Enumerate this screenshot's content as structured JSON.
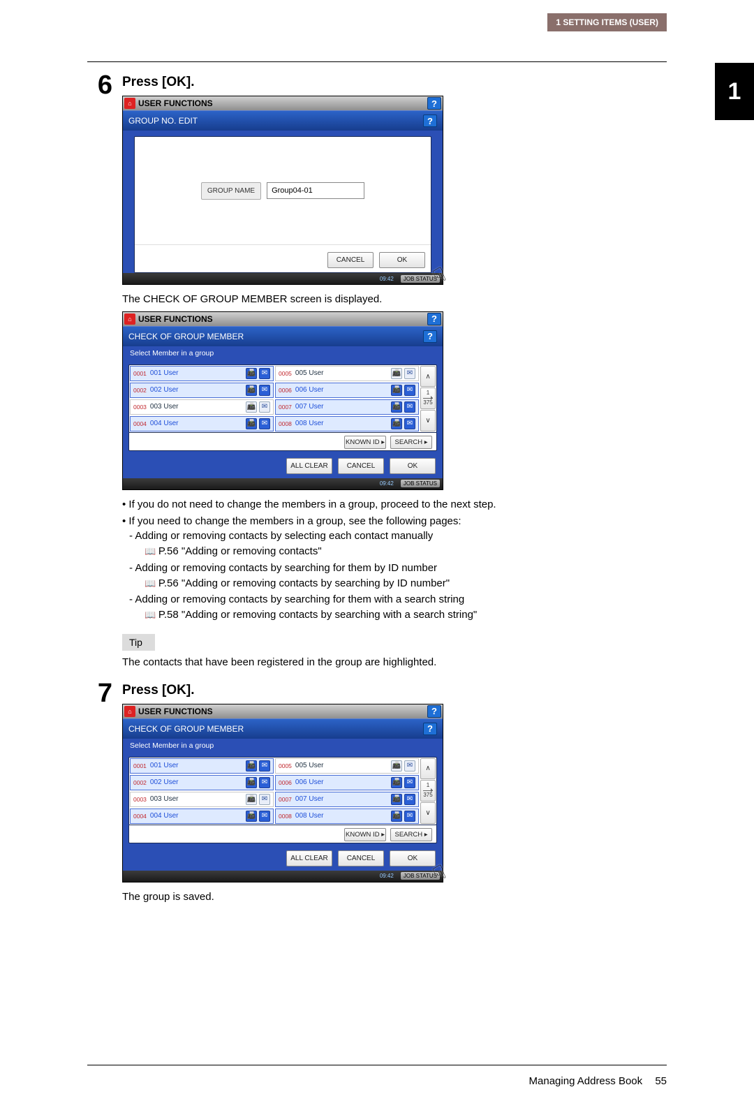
{
  "header": {
    "section": "1 SETTING ITEMS (USER)"
  },
  "chapter_tab": "1",
  "step6": {
    "number": "6",
    "title": "Press [OK].",
    "after_caption": "The CHECK OF GROUP MEMBER screen is displayed.",
    "bullets": [
      "If you do not need to change the members in a group, proceed to the next step.",
      "If you need to change the members in a group, see the following pages:"
    ],
    "subitems": [
      {
        "line": "Adding or removing contacts by selecting each contact manually",
        "ref": "P.56 \"Adding or removing contacts\""
      },
      {
        "line": "Adding or removing contacts by searching for them by ID number",
        "ref": "P.56 \"Adding or removing contacts by searching by ID number\""
      },
      {
        "line": "Adding or removing contacts by searching for them with a search string",
        "ref": "P.58 \"Adding or removing contacts by searching with a search string\""
      }
    ],
    "tip_label": "Tip",
    "tip_text": "The contacts that have been registered in the group are highlighted."
  },
  "step7": {
    "number": "7",
    "title": "Press [OK].",
    "after_caption": "The group is saved."
  },
  "ui_group_edit": {
    "window_title": "USER FUNCTIONS",
    "panel_title": "GROUP NO. EDIT",
    "group_name_label": "GROUP NAME",
    "group_name_value": "Group04-01",
    "cancel": "CANCEL",
    "ok": "OK",
    "time": "09:42",
    "job_status": "JOB STATUS"
  },
  "ui_member": {
    "window_title": "USER FUNCTIONS",
    "panel_title": "CHECK OF GROUP MEMBER",
    "instruction": "Select Member in a group",
    "known_id": "KNOWN ID",
    "search": "SEARCH",
    "all_clear": "ALL CLEAR",
    "cancel": "CANCEL",
    "ok": "OK",
    "page_current": "1",
    "page_total": "375",
    "time": "09:42",
    "job_status": "JOB STATUS",
    "rows": [
      {
        "l_idx": "0001",
        "l_name": "001 User",
        "l_fax_on": true,
        "l_mail_on": true,
        "r_idx": "0005",
        "r_name": "005 User",
        "r_fax_on": false,
        "r_mail_on": false,
        "l_sel": true,
        "r_sel": false
      },
      {
        "l_idx": "0002",
        "l_name": "002 User",
        "l_fax_on": true,
        "l_mail_on": true,
        "r_idx": "0006",
        "r_name": "006 User",
        "r_fax_on": true,
        "r_mail_on": true,
        "l_sel": true,
        "r_sel": true
      },
      {
        "l_idx": "0003",
        "l_name": "003 User",
        "l_fax_on": false,
        "l_mail_on": false,
        "r_idx": "0007",
        "r_name": "007 User",
        "r_fax_on": true,
        "r_mail_on": true,
        "l_sel": false,
        "r_sel": true
      },
      {
        "l_idx": "0004",
        "l_name": "004 User",
        "l_fax_on": true,
        "l_mail_on": true,
        "r_idx": "0008",
        "r_name": "008 User",
        "r_fax_on": true,
        "r_mail_on": true,
        "l_sel": true,
        "r_sel": true
      }
    ]
  },
  "footer": {
    "text": "Managing Address Book",
    "page": "55"
  }
}
